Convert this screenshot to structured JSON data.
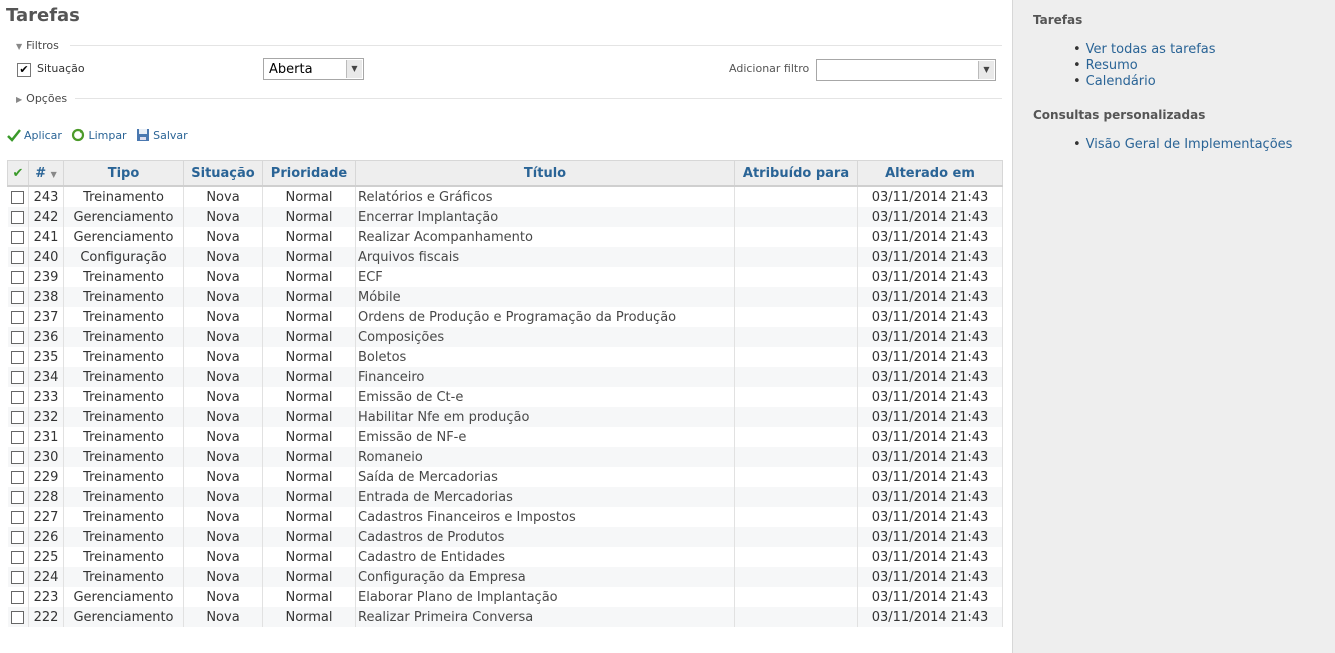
{
  "page_title": "Tarefas",
  "filters": {
    "legend": "Filtros",
    "situacao_label": "Situação",
    "situacao_checked": true,
    "situacao_value": "Aberta",
    "add_filter_label": "Adicionar filtro",
    "add_filter_value": ""
  },
  "options_legend": "Opções",
  "actions": {
    "apply": "Aplicar",
    "clear": "Limpar",
    "save": "Salvar"
  },
  "table": {
    "headers": [
      "#",
      "Tipo",
      "Situação",
      "Prioridade",
      "Título",
      "Atribuído para",
      "Alterado em"
    ],
    "rows": [
      {
        "id": "243",
        "tipo": "Treinamento",
        "situacao": "Nova",
        "prioridade": "Normal",
        "titulo": "Relatórios e Gráficos",
        "atribuido": "",
        "alterado": "03/11/2014 21:43"
      },
      {
        "id": "242",
        "tipo": "Gerenciamento",
        "situacao": "Nova",
        "prioridade": "Normal",
        "titulo": "Encerrar Implantação",
        "atribuido": "",
        "alterado": "03/11/2014 21:43"
      },
      {
        "id": "241",
        "tipo": "Gerenciamento",
        "situacao": "Nova",
        "prioridade": "Normal",
        "titulo": "Realizar Acompanhamento",
        "atribuido": "",
        "alterado": "03/11/2014 21:43"
      },
      {
        "id": "240",
        "tipo": "Configuração",
        "situacao": "Nova",
        "prioridade": "Normal",
        "titulo": "Arquivos fiscais",
        "atribuido": "",
        "alterado": "03/11/2014 21:43"
      },
      {
        "id": "239",
        "tipo": "Treinamento",
        "situacao": "Nova",
        "prioridade": "Normal",
        "titulo": "ECF",
        "atribuido": "",
        "alterado": "03/11/2014 21:43"
      },
      {
        "id": "238",
        "tipo": "Treinamento",
        "situacao": "Nova",
        "prioridade": "Normal",
        "titulo": "Móbile",
        "atribuido": "",
        "alterado": "03/11/2014 21:43"
      },
      {
        "id": "237",
        "tipo": "Treinamento",
        "situacao": "Nova",
        "prioridade": "Normal",
        "titulo": "Ordens de Produção e Programação da Produção",
        "atribuido": "",
        "alterado": "03/11/2014 21:43"
      },
      {
        "id": "236",
        "tipo": "Treinamento",
        "situacao": "Nova",
        "prioridade": "Normal",
        "titulo": "Composições",
        "atribuido": "",
        "alterado": "03/11/2014 21:43"
      },
      {
        "id": "235",
        "tipo": "Treinamento",
        "situacao": "Nova",
        "prioridade": "Normal",
        "titulo": "Boletos",
        "atribuido": "",
        "alterado": "03/11/2014 21:43"
      },
      {
        "id": "234",
        "tipo": "Treinamento",
        "situacao": "Nova",
        "prioridade": "Normal",
        "titulo": "Financeiro",
        "atribuido": "",
        "alterado": "03/11/2014 21:43"
      },
      {
        "id": "233",
        "tipo": "Treinamento",
        "situacao": "Nova",
        "prioridade": "Normal",
        "titulo": "Emissão de Ct-e",
        "atribuido": "",
        "alterado": "03/11/2014 21:43"
      },
      {
        "id": "232",
        "tipo": "Treinamento",
        "situacao": "Nova",
        "prioridade": "Normal",
        "titulo": "Habilitar Nfe em produção",
        "atribuido": "",
        "alterado": "03/11/2014 21:43"
      },
      {
        "id": "231",
        "tipo": "Treinamento",
        "situacao": "Nova",
        "prioridade": "Normal",
        "titulo": "Emissão de NF-e",
        "atribuido": "",
        "alterado": "03/11/2014 21:43"
      },
      {
        "id": "230",
        "tipo": "Treinamento",
        "situacao": "Nova",
        "prioridade": "Normal",
        "titulo": "Romaneio",
        "atribuido": "",
        "alterado": "03/11/2014 21:43"
      },
      {
        "id": "229",
        "tipo": "Treinamento",
        "situacao": "Nova",
        "prioridade": "Normal",
        "titulo": "Saída de Mercadorias",
        "atribuido": "",
        "alterado": "03/11/2014 21:43"
      },
      {
        "id": "228",
        "tipo": "Treinamento",
        "situacao": "Nova",
        "prioridade": "Normal",
        "titulo": "Entrada de Mercadorias",
        "atribuido": "",
        "alterado": "03/11/2014 21:43"
      },
      {
        "id": "227",
        "tipo": "Treinamento",
        "situacao": "Nova",
        "prioridade": "Normal",
        "titulo": "Cadastros Financeiros e Impostos",
        "atribuido": "",
        "alterado": "03/11/2014 21:43"
      },
      {
        "id": "226",
        "tipo": "Treinamento",
        "situacao": "Nova",
        "prioridade": "Normal",
        "titulo": "Cadastros de Produtos",
        "atribuido": "",
        "alterado": "03/11/2014 21:43"
      },
      {
        "id": "225",
        "tipo": "Treinamento",
        "situacao": "Nova",
        "prioridade": "Normal",
        "titulo": "Cadastro de Entidades",
        "atribuido": "",
        "alterado": "03/11/2014 21:43"
      },
      {
        "id": "224",
        "tipo": "Treinamento",
        "situacao": "Nova",
        "prioridade": "Normal",
        "titulo": "Configuração da Empresa",
        "atribuido": "",
        "alterado": "03/11/2014 21:43"
      },
      {
        "id": "223",
        "tipo": "Gerenciamento",
        "situacao": "Nova",
        "prioridade": "Normal",
        "titulo": "Elaborar Plano de Implantação",
        "atribuido": "",
        "alterado": "03/11/2014 21:43"
      },
      {
        "id": "222",
        "tipo": "Gerenciamento",
        "situacao": "Nova",
        "prioridade": "Normal",
        "titulo": "Realizar Primeira Conversa",
        "atribuido": "",
        "alterado": "03/11/2014 21:43"
      }
    ]
  },
  "sidebar": {
    "tasks_title": "Tarefas",
    "tasks_links": [
      "Ver todas as tarefas",
      "Resumo",
      "Calendário"
    ],
    "queries_title": "Consultas personalizadas",
    "queries_links": [
      "Visão Geral de Implementações"
    ]
  },
  "colors": {
    "link": "#2a6496",
    "sidebar_bg": "#eeeeee",
    "row_alt": "#f6f7f8"
  },
  "icons": {
    "apply": "check-icon",
    "clear": "reload-icon",
    "save": "save-icon"
  }
}
